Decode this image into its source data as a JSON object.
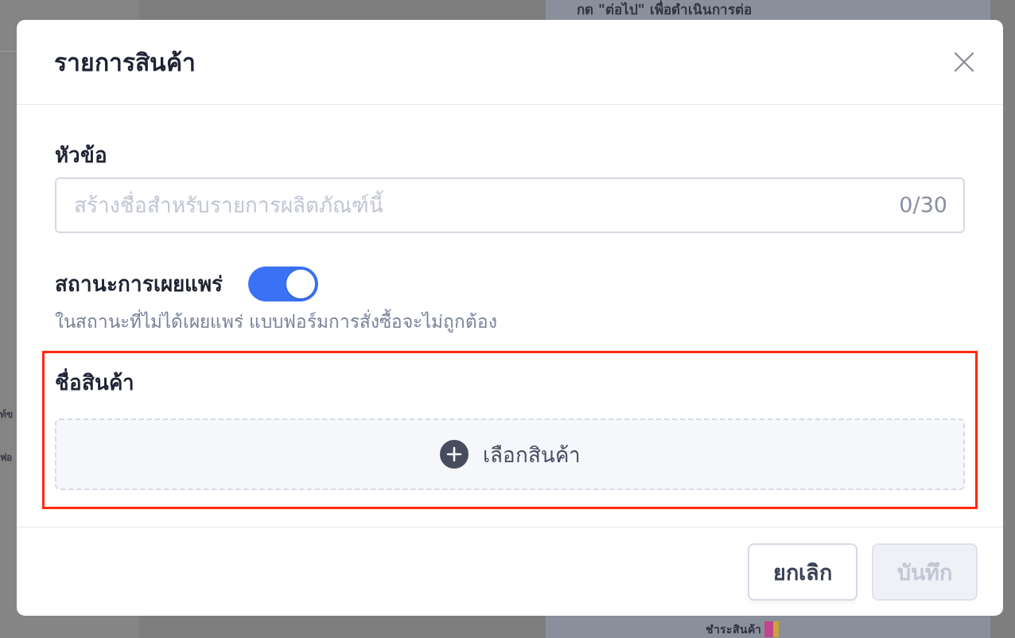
{
  "background": {
    "banner_text": "กด \"ต่อไป\" เพื่อดำเนินการต่อ",
    "side_fragments": [
      "ท์ข",
      "ฟอ"
    ],
    "footer_text": "ชำระสินค้า"
  },
  "dialog": {
    "title": "รายการสินค้า",
    "title_field": {
      "label": "หัวข้อ",
      "placeholder": "สร้างชื่อสำหรับรายการผลิตภัณฑ์นี้",
      "counter": "0/30"
    },
    "publish": {
      "label": "สถานะการเผยแพร่",
      "on": true,
      "hint": "ในสถานะที่ไม่ได้เผยแพร่ แบบฟอร์มการสั่งซื้อจะไม่ถูกต้อง"
    },
    "product_section": {
      "label": "ชื่อสินค้า",
      "highlighted": true,
      "picker": "เลือกสินค้า"
    },
    "buttons": [
      {
        "label": "ยกเลิก",
        "disabled": false
      },
      {
        "label": "บันทึก",
        "disabled": true
      }
    ]
  }
}
